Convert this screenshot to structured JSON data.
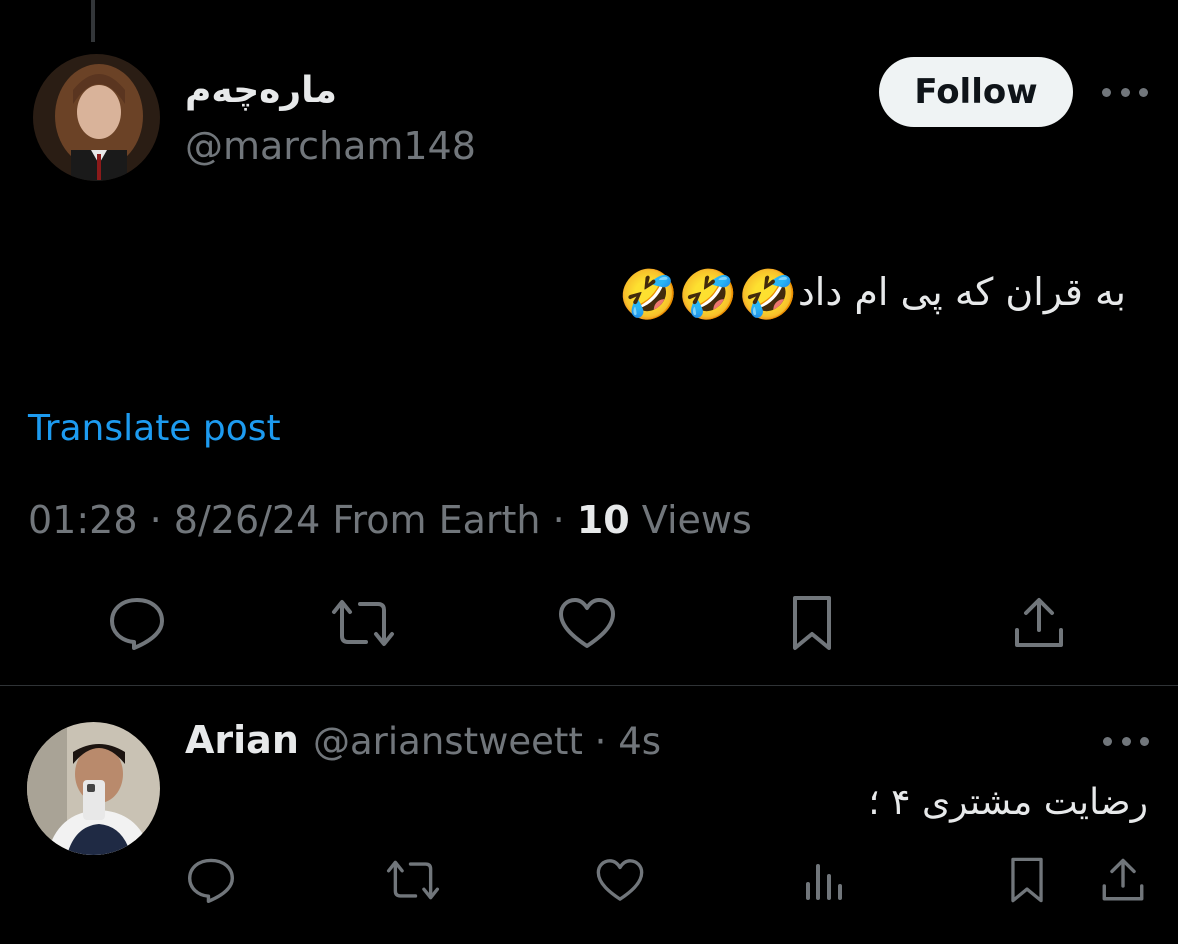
{
  "post": {
    "display_name": "مارەچەم",
    "handle": "@marcham148",
    "follow_label": "Follow",
    "text": "به قران که پی ام داد",
    "emoji": [
      "🤣",
      "🤣",
      "🤣"
    ],
    "translate_label": "Translate post",
    "time": "01:28",
    "date": "8/26/24",
    "source": "From Earth",
    "views_count": "10",
    "views_label": "Views",
    "separator": "·"
  },
  "reply": {
    "display_name": "Arian",
    "handle": "@arianstweett",
    "separator": "·",
    "time_ago": "4s",
    "text": "رضایت مشتری ۴ ؛"
  },
  "icons": {
    "reply": "reply-icon",
    "repost": "repost-icon",
    "like": "like-icon",
    "bookmark": "bookmark-icon",
    "share": "share-icon",
    "analytics": "analytics-icon",
    "more": "more-icon"
  },
  "colors": {
    "background": "#000000",
    "text": "#e7e9ea",
    "muted": "#71767b",
    "link": "#1d9bf0",
    "emoji": "#f7c233"
  }
}
